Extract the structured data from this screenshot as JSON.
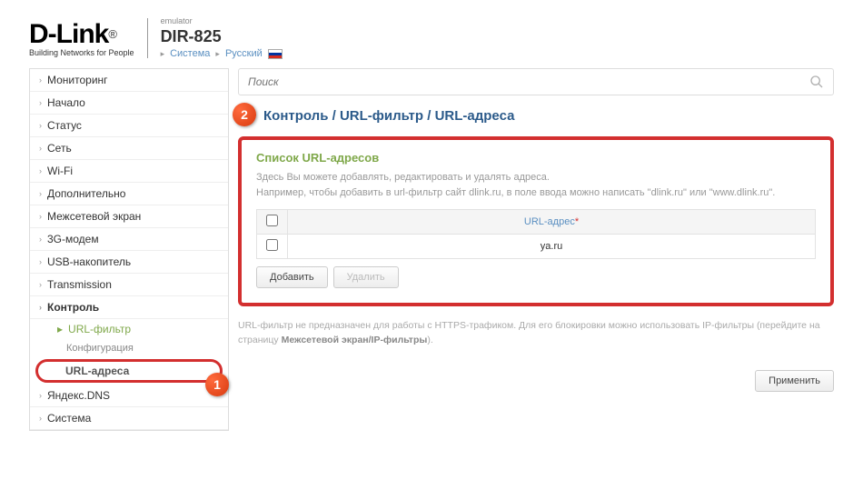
{
  "header": {
    "logo_main": "D-Link",
    "logo_reg": "®",
    "logo_sub": "Building Networks for People",
    "emulator": "emulator",
    "model": "DIR-825",
    "system_link": "Система",
    "lang_link": "Русский"
  },
  "sidebar": {
    "items": [
      "Мониторинг",
      "Начало",
      "Статус",
      "Сеть",
      "Wi-Fi",
      "Дополнительно",
      "Межсетевой экран",
      "3G-модем",
      "USB-накопитель",
      "Transmission",
      "Контроль"
    ],
    "sub_url_filter": "URL-фильтр",
    "sub_config": "Конфигурация",
    "sub_url_addresses": "URL-адреса",
    "items_after": [
      "Яндекс.DNS",
      "Система"
    ]
  },
  "markers": {
    "m1": "1",
    "m2": "2"
  },
  "search": {
    "placeholder": "Поиск"
  },
  "breadcrumb": {
    "p1": "Контроль",
    "p2": "URL-фильтр",
    "p3": "URL-адреса",
    "sep": " / "
  },
  "panel": {
    "title": "Список URL-адресов",
    "desc1": "Здесь Вы можете добавлять, редактировать и удалять адреса.",
    "desc2": "Например, чтобы добавить в url-фильтр сайт dlink.ru, в поле ввода можно написать \"dlink.ru\" или \"www.dlink.ru\".",
    "col_header": "URL-адрес",
    "rows": [
      "ya.ru"
    ],
    "add_btn": "Добавить",
    "del_btn": "Удалить"
  },
  "note": {
    "text1": "URL-фильтр не предназначен для работы с HTTPS-трафиком. Для его блокировки можно использовать IP-фильтры (перейдите на страницу ",
    "link": "Межсетевой экран/IP-фильтры",
    "text2": ")."
  },
  "apply_btn": "Применить"
}
